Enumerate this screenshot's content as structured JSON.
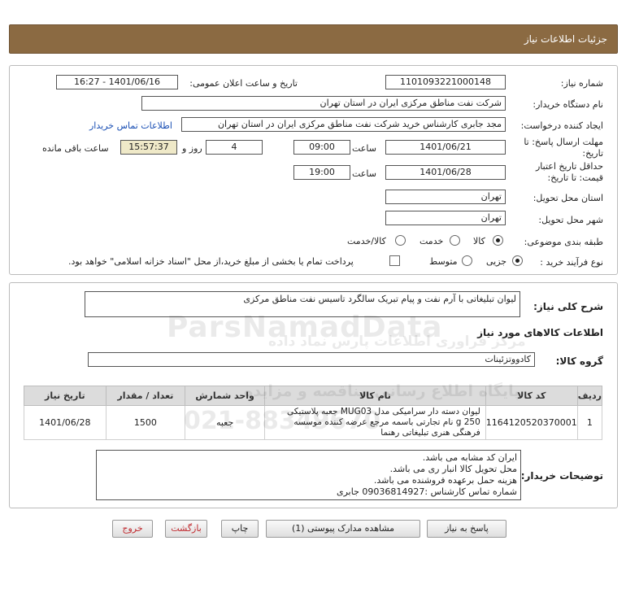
{
  "header": {
    "title": "جزئیات اطلاعات نیاز"
  },
  "form": {
    "need_number_label": "شماره نیاز:",
    "need_number": "1101093221000148",
    "announce_label": "تاریخ و ساعت اعلان عمومی:",
    "announce_value": "1401/06/16 - 16:27",
    "buyer_org_label": "نام دستگاه خریدار:",
    "buyer_org": "شرکت نفت مناطق مرکزی ایران در استان تهران",
    "requester_label": "ایجاد کننده درخواست:",
    "requester": "مجد جابری کارشناس خرید شرکت نفت مناطق مرکزی ایران در استان تهران",
    "contact_link": "اطلاعات تماس خریدار",
    "reply_deadline_label": "مهلت ارسال پاسخ: تا تاریخ:",
    "reply_date": "1401/06/21",
    "time_label": "ساعت",
    "reply_time": "09:00",
    "days_value": "4",
    "days_label": "روز و",
    "remaining_time": "15:57:37",
    "remaining_label": "ساعت باقی مانده",
    "validity_label": "حداقل تاریخ اعتبار قیمت: تا تاریخ:",
    "validity_date": "1401/06/28",
    "validity_time": "19:00",
    "province_label": "استان محل تحویل:",
    "province": "تهران",
    "city_label": "شهر محل تحویل:",
    "city": "تهران",
    "category_label": "طبقه بندی موضوعی:",
    "category_options": [
      "کالا",
      "خدمت",
      "کالا/خدمت"
    ],
    "process_label": "نوع فرآیند خرید :",
    "process_options": [
      "جزیی",
      "متوسط"
    ],
    "payment_note": "پرداخت تمام یا بخشی از مبلغ خرید،از محل \"اسناد خزانه اسلامی\" خواهد بود."
  },
  "summary": {
    "desc_label": "شرح کلی نیاز:",
    "desc_value": "لیوان تبلیغاتی با آرم نفت و پیام تبریک سالگرد تاسیس نفت مناطق مرکزی",
    "goods_info_title": "اطلاعات کالاهای مورد نیاز",
    "group_label": "گروه کالا:",
    "group_value": "کادووتزئینات"
  },
  "table": {
    "headers": [
      "ردیف",
      "کد کالا",
      "نام کالا",
      "واحد شمارش",
      "تعداد / مقدار",
      "تاریخ نیاز"
    ],
    "row": {
      "idx": "1",
      "code": "1164120520370001",
      "name": "لیوان دسته دار سرامیکی مدل MUG03 جعبه پلاستیکی 250 g نام تجارتی باسمه مرجع عرضه کننده موسسه فرهنگی هنری تبلیغاتی رهنما",
      "unit": "جعبه",
      "qty": "1500",
      "date": "1401/06/28"
    }
  },
  "buyer_notes": {
    "label": "توضیحات خریدار:",
    "lines": [
      "ایران کد مشابه می باشد.",
      "محل تحویل کالا انبار ری می باشد.",
      "هزینه حمل برعهده فروشنده می باشد.",
      "شماره تماس کارشناس :09036814927 جابری"
    ]
  },
  "buttons": {
    "reply": "پاسخ به نیاز",
    "view_docs": "مشاهده مدارک پیوستی (1)",
    "print": "چاپ",
    "back": "بازگشت",
    "exit": "خروج"
  },
  "watermark": {
    "brand": "ParsNamadData",
    "line1": "مرکز فراوری اطلاعات پارس نماد داده",
    "line2": "پایگاه اطلاع رسانی مناقصه و مزایده",
    "phone": "021-88349670"
  }
}
